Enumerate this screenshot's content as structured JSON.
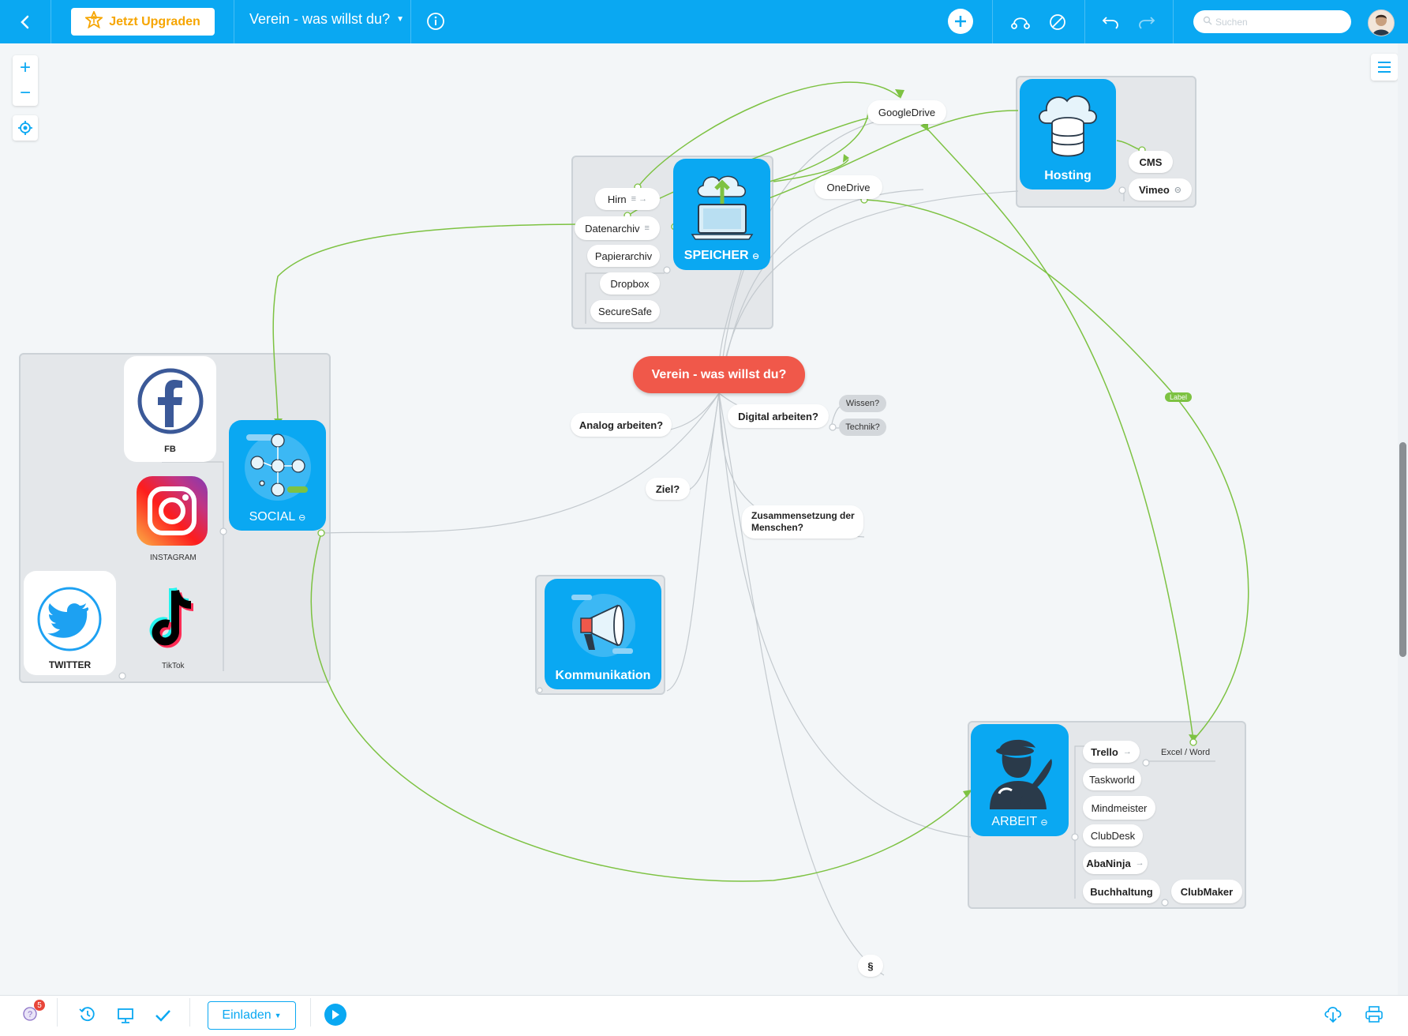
{
  "toolbar": {
    "upgrade_label": "Jetzt Upgraden",
    "map_title": "Verein - was willst du?",
    "search_placeholder": "Suchen"
  },
  "map": {
    "root": "Verein - was willst du?",
    "speicher": {
      "label": "SPEICHER",
      "children": [
        "Hirn",
        "Datenarchiv",
        "Papierarchiv",
        "Dropbox",
        "SecureSafe"
      ]
    },
    "googledrive": "GoogleDrive",
    "onedrive": "OneDrive",
    "hosting": {
      "label": "Hosting",
      "children": [
        "CMS",
        "Vimeo"
      ]
    },
    "social": {
      "label": "SOCIAL",
      "children": [
        "FB",
        "INSTAGRAM",
        "TWITTER",
        "TikTok"
      ]
    },
    "topics": {
      "analog": "Analog arbeiten?",
      "digital": "Digital arbeiten?",
      "wissen": "Wissen?",
      "technik": "Technik?",
      "ziel": "Ziel?",
      "zusammensetzung_line1": "Zusammensetzung der",
      "zusammensetzung_line2": "Menschen?",
      "paragraph": "§"
    },
    "kommunikation": "Kommunikation",
    "arbeit": {
      "label": "ARBEIT",
      "children": [
        "Trello",
        "Taskworld",
        "Mindmeister",
        "ClubDesk",
        "AbaNinja",
        "Buchhaltung",
        "ClubMaker"
      ],
      "excel_word": "Excel / Word"
    },
    "connection_label": "Label"
  },
  "bottom": {
    "notification_count": "5",
    "invite_label": "Einladen"
  },
  "colors": {
    "brand": "#0aa8f2",
    "root": "#f0584a",
    "connection": "#7dc242",
    "upgrade": "#f6a500"
  },
  "icons": [
    "back-icon",
    "star-icon",
    "dropdown-icon",
    "info-icon",
    "add-icon",
    "connect-icon",
    "clear-icon",
    "undo-icon",
    "redo-icon",
    "search-icon",
    "zoom-in-icon",
    "zoom-out-icon",
    "locate-icon",
    "menu-icon",
    "history-icon",
    "present-icon",
    "check-icon",
    "play-icon",
    "cloud-download-icon",
    "print-icon",
    "help-icon"
  ]
}
